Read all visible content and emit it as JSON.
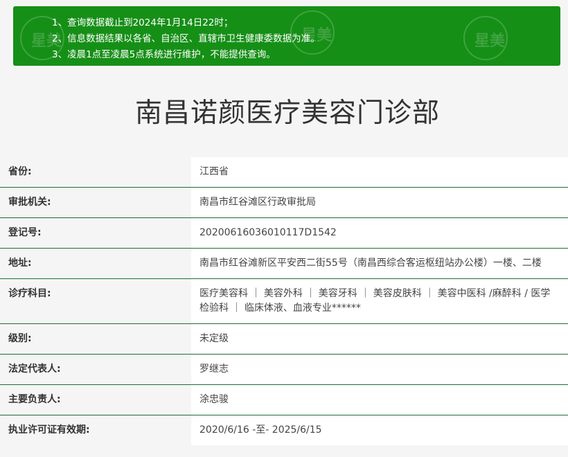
{
  "notice": {
    "lines": [
      "1、查询数据截止到2024年1月14日22时；",
      "2、信息数据结果以各省、自治区、直辖市卫生健康委数据为准。",
      "3、凌晨1点至凌晨5点系统进行维护，不能提供查询。"
    ],
    "bg_color": "#168f17"
  },
  "title": "南昌诺颜医疗美容门诊部",
  "fields": [
    {
      "label": "省份:",
      "value": "江西省"
    },
    {
      "label": "审批机关:",
      "value": "南昌市红谷滩区行政审批局"
    },
    {
      "label": "登记号:",
      "value": "20200616036010117D1542"
    },
    {
      "label": "地址:",
      "value": "南昌市红谷滩新区平安西二街55号（南昌西综合客运枢纽站办公楼）一楼、二楼"
    },
    {
      "label": "诊疗科目:",
      "value": "医疗美容科 ｜ 美容外科 ｜ 美容牙科 ｜ 美容皮肤科 ｜ 美容中医科 /麻醉科 / 医学检验科 ｜ 临床体液、血液专业******"
    },
    {
      "label": "级别:",
      "value": "未定级"
    },
    {
      "label": "法定代表人:",
      "value": "罗继志"
    },
    {
      "label": "主要负责人:",
      "value": "涂忠骏"
    },
    {
      "label": "执业许可证有效期:",
      "value": "2020/6/16 -至- 2025/6/15"
    }
  ],
  "watermark_text": "星美"
}
